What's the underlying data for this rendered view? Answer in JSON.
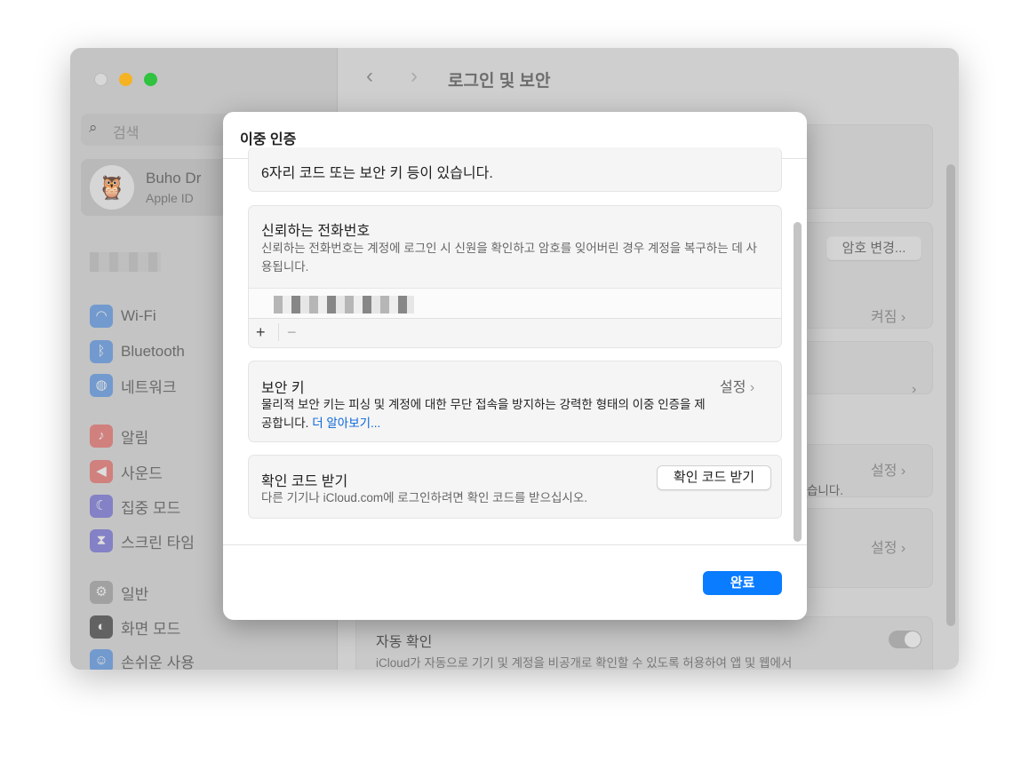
{
  "window": {
    "title": "로그인 및 보안"
  },
  "sidebar": {
    "search_placeholder": "검색",
    "profile": {
      "name": "Buho Dr",
      "subtitle": "Apple ID"
    },
    "items": [
      {
        "label": "Wi-Fi",
        "icon": "wifi-icon",
        "color": "#3d7fd6"
      },
      {
        "label": "Bluetooth",
        "icon": "bluetooth-icon",
        "color": "#3d7fd6"
      },
      {
        "label": "네트워크",
        "icon": "globe-icon",
        "color": "#3d7fd6"
      },
      {
        "label": "알림",
        "icon": "bell-icon",
        "color": "#d9534f"
      },
      {
        "label": "사운드",
        "icon": "speaker-icon",
        "color": "#d9534f"
      },
      {
        "label": "집중 모드",
        "icon": "moon-icon",
        "color": "#5a55c8"
      },
      {
        "label": "스크린 타임",
        "icon": "hourglass-icon",
        "color": "#5a55c8"
      },
      {
        "label": "일반",
        "icon": "gear-icon",
        "color": "#8a8a8a"
      },
      {
        "label": "화면 모드",
        "icon": "appearance-icon",
        "color": "#222222"
      },
      {
        "label": "손쉬운 사용",
        "icon": "accessibility-icon",
        "color": "#3d7fd6"
      }
    ]
  },
  "main": {
    "change_password": "암호 변경...",
    "two_factor_status": "켜짐",
    "setup_1": "설정",
    "partial_text": "습니다.",
    "setup_2": "설정",
    "auto_verify": {
      "title": "자동 확인",
      "desc": "iCloud가 자동으로 기기 및 계정을 비공개로 확인할 수 있도록 허용하여 앱 및 웹에서",
      "enabled": true
    }
  },
  "dialog": {
    "title": "이중 인증",
    "partial_text": "6자리 코드 또는 보안 키 등이 있습니다.",
    "trusted_phone": {
      "title": "신뢰하는 전화번호",
      "desc": "신뢰하는 전화번호는 계정에 로그인 시 신원을 확인하고 암호를 잊어버린 경우 계정을 복구하는 데 사용됩니다.",
      "add": "+",
      "remove": "−"
    },
    "security_key": {
      "title": "보안 키",
      "action": "설정",
      "desc": "물리적 보안 키는 피싱 및 계정에 대한 무단 접속을 방지하는 강력한 형태의 이중 인증을 제공합니다.",
      "link": "더 알아보기..."
    },
    "verification_code": {
      "title": "확인 코드 받기",
      "desc": "다른 기기나 iCloud.com에 로그인하려면 확인 코드를 받으십시오.",
      "button": "확인 코드 받기"
    },
    "done": "완료",
    "accent": "#0a7cff"
  }
}
